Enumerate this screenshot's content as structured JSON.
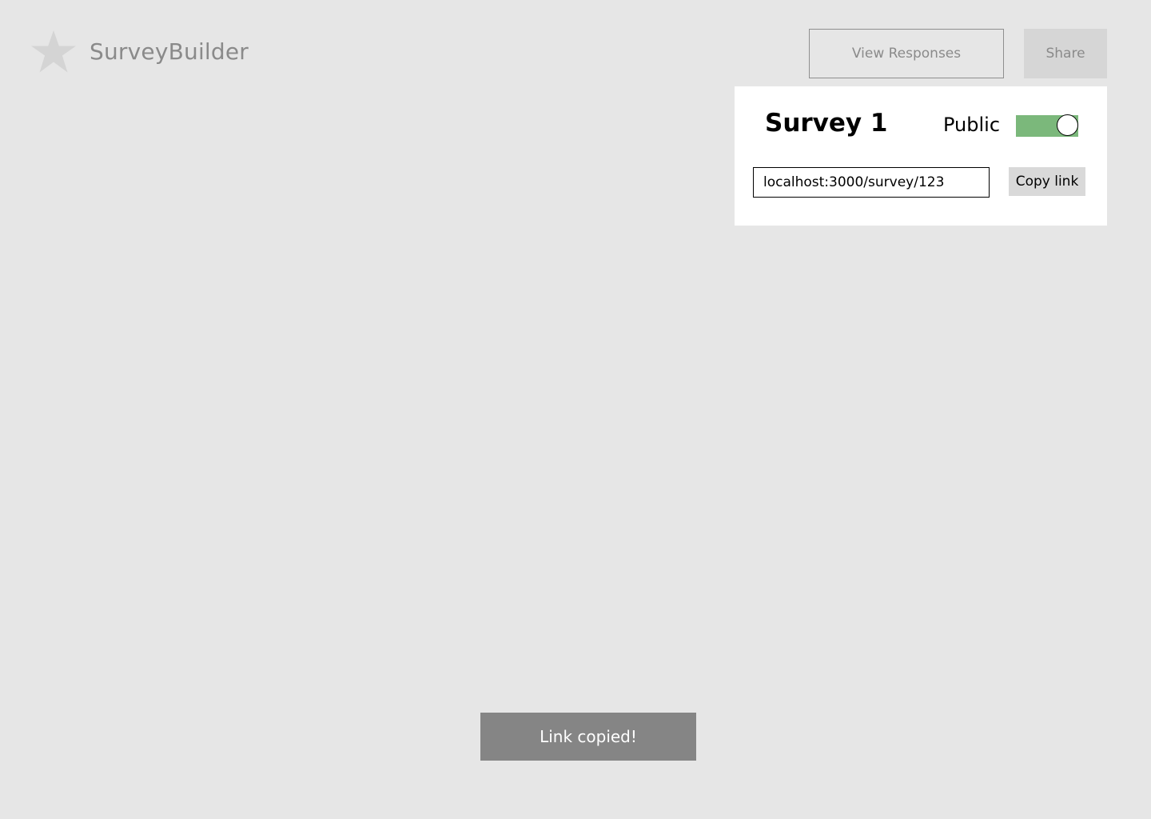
{
  "app": {
    "title": "SurveyBuilder",
    "logo_icon": "star-icon",
    "logo_color": "#d4d4d4"
  },
  "toolbar": {
    "view_responses_label": "View Responses",
    "share_label": "Share"
  },
  "share_panel": {
    "survey_title": "Survey 1",
    "public_label": "Public",
    "public_enabled": true,
    "toggle_on_color": "#7bb87b",
    "link_value": "localhost:3000/survey/123",
    "copy_link_label": "Copy link"
  },
  "toast": {
    "message": "Link copied!"
  }
}
